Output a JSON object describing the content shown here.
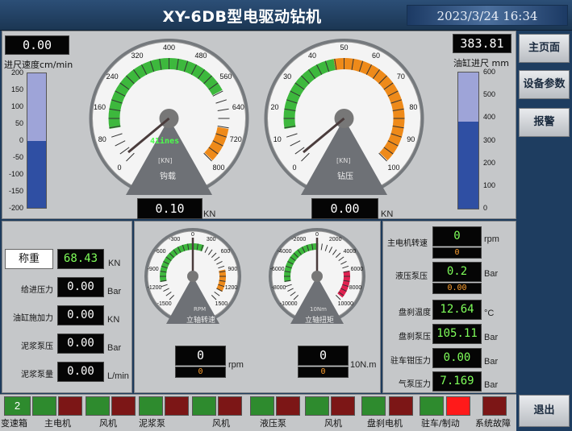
{
  "header": {
    "title": "XY-6DB型电驱动钻机",
    "datetime": "2023/3/24 16:34"
  },
  "nav": {
    "home": "主页面",
    "params": "设备参数",
    "alarm": "报警",
    "exit": "退出"
  },
  "feed_speed": {
    "value": "0.00",
    "label": "进尺速度cm/min",
    "ticks": [
      "200",
      "150",
      "100",
      "50",
      "0",
      "-50",
      "-100",
      "-150",
      "-200"
    ],
    "level": 0.5
  },
  "cyl_feed": {
    "value": "383.81",
    "label": "油缸进尺 mm",
    "ticks": [
      "600",
      "500",
      "400",
      "300",
      "200",
      "100",
      "0"
    ],
    "level": 0.64
  },
  "gauge_hook": {
    "ticks": [
      "0",
      "80",
      "160",
      "240",
      "320",
      "400",
      "480",
      "560",
      "640",
      "720",
      "800"
    ],
    "inner_text": "41ines",
    "unit": "[KN]",
    "name": "钩载",
    "value": "0.10",
    "value_unit": "KN"
  },
  "gauge_bit": {
    "ticks": [
      "0",
      "10",
      "20",
      "30",
      "40",
      "50",
      "60",
      "70",
      "80",
      "90",
      "100"
    ],
    "unit": "[KN]",
    "name": "钻压",
    "value": "0.00",
    "value_unit": "KN"
  },
  "left_params": {
    "weigh_btn": "称重",
    "weigh_value": "68.43",
    "weigh_unit": "KN",
    "rows": [
      {
        "label": "给进压力",
        "value": "0.00",
        "unit": "Bar"
      },
      {
        "label": "油缸施加力",
        "value": "0.00",
        "unit": "KN"
      },
      {
        "label": "泥浆泵压",
        "value": "0.00",
        "unit": "Bar"
      },
      {
        "label": "泥浆泵量",
        "value": "0.00",
        "unit": "L/min"
      }
    ]
  },
  "gauge_rpm": {
    "ticks": [
      "-1500",
      "-1200",
      "-900",
      "-600",
      "-300",
      "0",
      "300",
      "600",
      "900",
      "1200",
      "1500"
    ],
    "unit": "RPM",
    "name": "立轴转速",
    "value": "0",
    "sub_value": "0",
    "value_unit": "rpm"
  },
  "gauge_torque": {
    "ticks": [
      "-10000",
      "-8000",
      "-6000",
      "-4000",
      "-2000",
      "0",
      "2000",
      "4000",
      "6000",
      "8000",
      "10000"
    ],
    "unit": "10Nm",
    "name": "立轴扭矩",
    "value": "0",
    "sub_value": "0",
    "value_unit": "10N.m"
  },
  "right_params": {
    "motor_speed": {
      "label": "主电机转速",
      "value": "0",
      "sub_value": "0",
      "unit": "rpm"
    },
    "hyd_pump": {
      "label": "液压泵压",
      "value": "0.2",
      "sub_value": "0.00",
      "unit": "Bar"
    },
    "rows": [
      {
        "label": "盘刹温度",
        "value": "12.64",
        "unit": "°C"
      },
      {
        "label": "盘刹泵压",
        "value": "105.11",
        "unit": "Bar"
      },
      {
        "label": "驻车钳压力",
        "value": "0.00",
        "unit": "Bar"
      },
      {
        "label": "气泵压力",
        "value": "7.169",
        "unit": "Bar"
      }
    ]
  },
  "bottom": {
    "gearbox": {
      "value": "2",
      "label": "变速箱"
    },
    "labels": [
      "主电机",
      "风机",
      "泥浆泵",
      "风机",
      "液压泵",
      "风机",
      "盘刹电机",
      "驻车/制动",
      "系统故障"
    ],
    "colors": {
      "green": "#2e8b2e",
      "red": "#7c1616",
      "bright_red": "#ff1a1a"
    }
  }
}
